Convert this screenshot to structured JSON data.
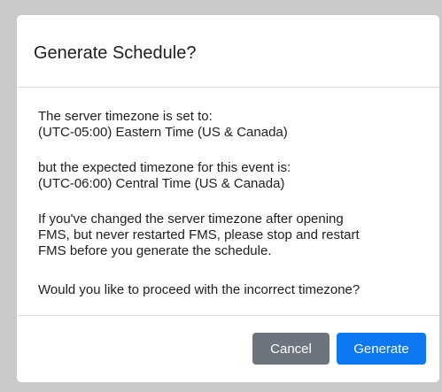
{
  "dialog": {
    "title": "Generate Schedule?",
    "body": {
      "server_tz_intro": "The server timezone is set to:",
      "server_tz_value": " (UTC-05:00) Eastern Time (US & Canada)",
      "expected_tz_intro": " but the expected timezone for this event is:",
      "expected_tz_value": "(UTC-06:00) Central Time (US & Canada)",
      "warning_line1": "If you've changed the server timezone after opening",
      "warning_line2": "FMS, but never restarted FMS, please stop and restart",
      "warning_line3": "FMS before you generate the schedule.",
      "question": " Would you like to proceed with the incorrect timezone?"
    },
    "buttons": {
      "cancel_label": "Cancel",
      "generate_label": "Generate"
    }
  },
  "colors": {
    "backdrop": "#c9c9c9",
    "cancel_button": "#6c757d",
    "generate_button": "#0d78f2"
  }
}
